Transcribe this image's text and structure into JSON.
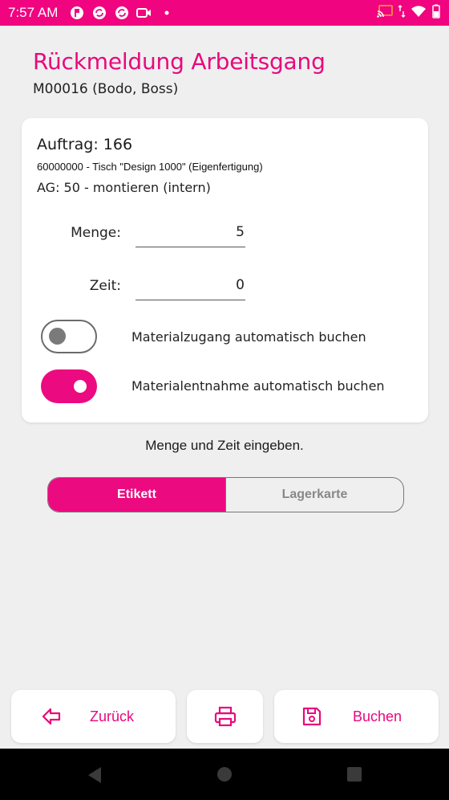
{
  "status_bar": {
    "time": "7:57 AM",
    "icons": [
      "flag-app-icon",
      "sync-icon",
      "sync-icon",
      "video-icon",
      "dot-icon",
      "cast-icon",
      "data-arrows-icon",
      "wifi-icon",
      "battery-icon"
    ]
  },
  "header": {
    "title": "Rückmeldung Arbeitsgang",
    "subtitle": "M00016 (Bodo, Boss)"
  },
  "card": {
    "order": "Auftrag: 166",
    "article": "60000000 - Tisch \"Design 1000\" (Eigenfertigung)",
    "operation": "AG: 50 - montieren (intern)",
    "quantity_label": "Menge:",
    "quantity_value": "5",
    "time_label": "Zeit:",
    "time_value": "0",
    "toggle_material_in_label": "Materialzugang automatisch buchen",
    "toggle_material_in_on": false,
    "toggle_material_out_label": "Materialentnahme automatisch buchen",
    "toggle_material_out_on": true
  },
  "hint": "Menge und Zeit eingeben.",
  "segmented": {
    "options": [
      "Etikett",
      "Lagerkarte"
    ],
    "selected": "Etikett"
  },
  "bottom_buttons": {
    "back_label": "Zurück",
    "book_label": "Buchen"
  },
  "colors": {
    "accent": "#ec0a80",
    "background": "#efefef"
  }
}
